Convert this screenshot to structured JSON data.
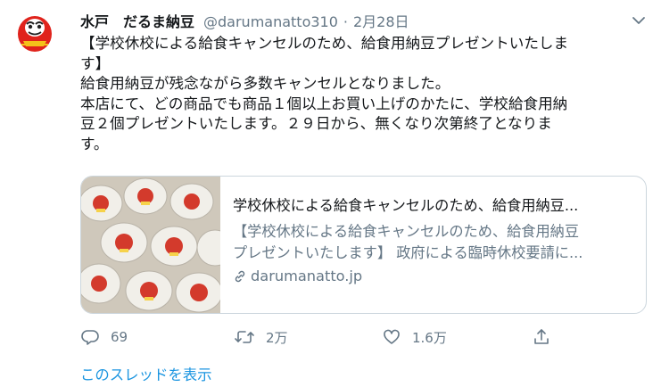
{
  "tweet": {
    "display_name": "水戸　だるま納豆",
    "handle": "@darumanatto310",
    "separator": "·",
    "date": "2月28日",
    "text_lines": [
      "【学校休校による給食キャンセルのため、給食用納豆プレゼントいたしま",
      "す】",
      "給食用納豆が残念ながら多数キャンセルとなりました。",
      "本店にて、どの商品でも商品１個以上お買い上げのかたに、学校給食用納",
      "豆２個プレゼントいたします。２９日から、無くなり次第終了となりま",
      "す。"
    ]
  },
  "card": {
    "title": "学校休校による給食キャンセルのため、給食用納豆...",
    "desc_lines": [
      "【学校休校による給食キャンセルのため、給食用納豆",
      "プレゼントいたします】 政府による臨時休校要請に..."
    ],
    "domain": "darumanatto.jp"
  },
  "actions": {
    "reply_count": "69",
    "retweet_count": "2万",
    "like_count": "1.6万"
  },
  "thread_link": "このスレッドを表示",
  "colors": {
    "text": "#14171a",
    "secondary": "#657786",
    "link": "#1b95e0",
    "border": "#ccd6dd"
  }
}
